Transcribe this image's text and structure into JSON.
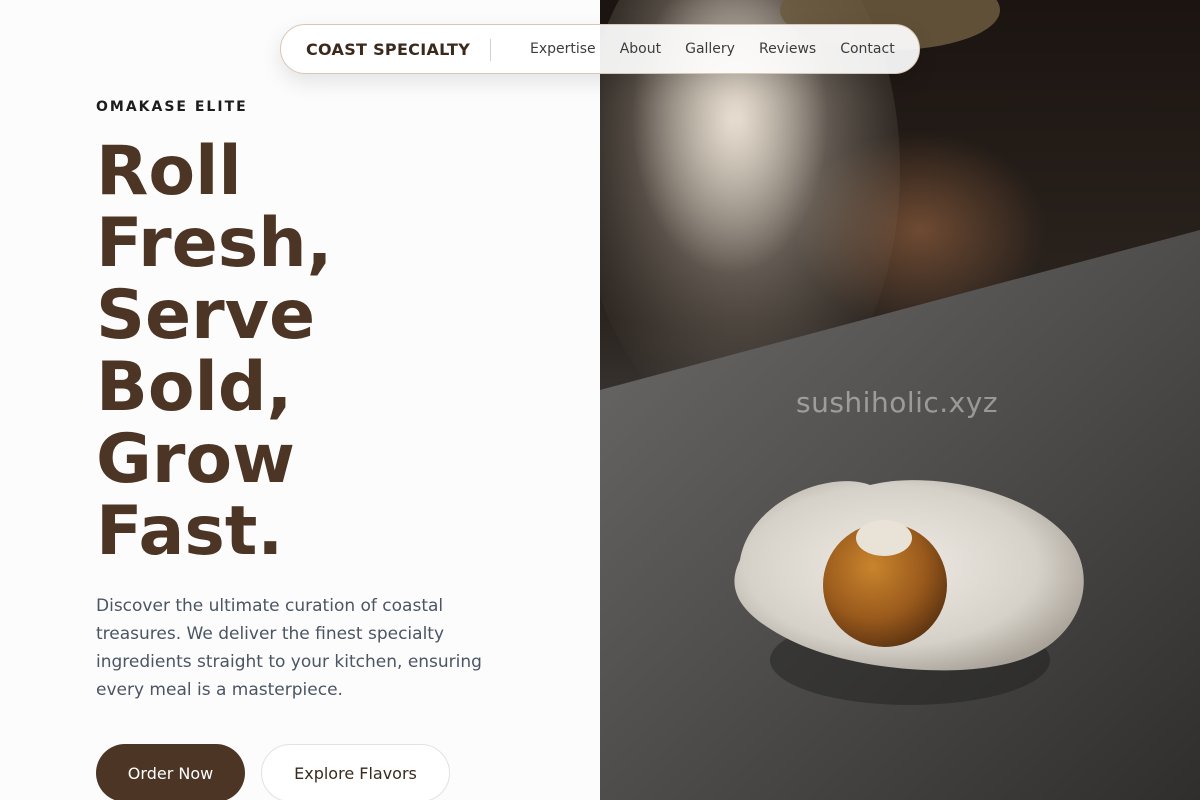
{
  "nav": {
    "brand": "COAST SPECIALTY",
    "links": [
      "Expertise",
      "About",
      "Gallery",
      "Reviews",
      "Contact"
    ]
  },
  "hero": {
    "eyebrow": "OMAKASE ELITE",
    "headline_lines": [
      "Roll",
      "Fresh,",
      "Serve",
      "Bold,",
      "Grow",
      "Fast."
    ],
    "lede": "Discover the ultimate curation of coastal treasures. We deliver the finest specialty ingredients straight to your kitchen, ensuring every meal is a masterpiece.",
    "primary_cta": "Order Now",
    "secondary_cta": "Explore Flavors"
  },
  "photo": {
    "watermark": "sushiholic.xyz"
  },
  "colors": {
    "brand_brown": "#4c3524",
    "text_gray": "#4b5563",
    "nav_border": "#d8c7b6"
  }
}
